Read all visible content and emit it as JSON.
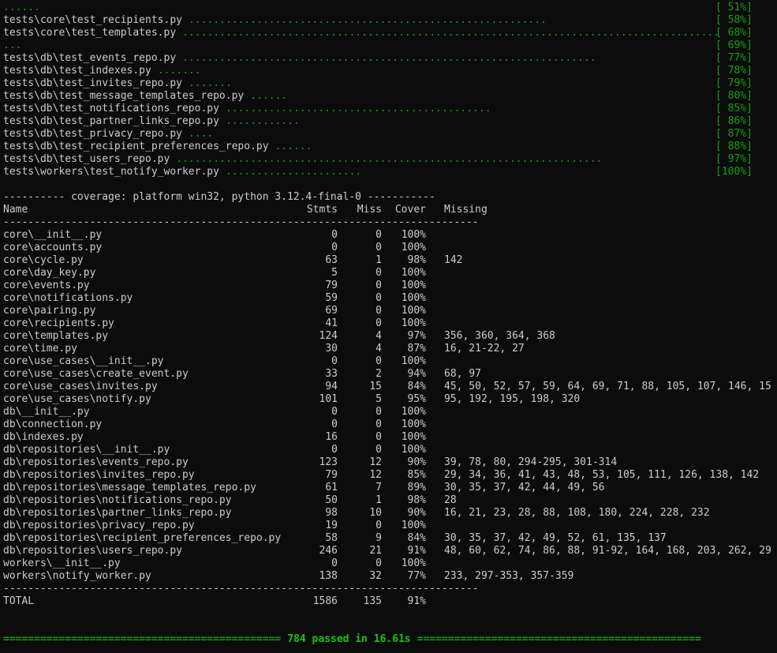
{
  "progress": [
    {
      "name": "",
      "dots": "......",
      "pct": "[ 51%]"
    },
    {
      "name": "tests\\core\\test_recipients.py",
      "dots": "..........................................................",
      "pct": "[ 58%]"
    },
    {
      "name": "tests\\core\\test_templates.py",
      "dots": ".......................................................................................",
      "pct": "[ 68%]"
    },
    {
      "name": "",
      "dots": "...",
      "pct": "[ 69%]"
    },
    {
      "name": "tests\\db\\test_events_repo.py",
      "dots": "...................................................................",
      "pct": "[ 77%]"
    },
    {
      "name": "tests\\db\\test_indexes.py",
      "dots": ".......",
      "pct": "[ 78%]"
    },
    {
      "name": "tests\\db\\test_invites_repo.py",
      "dots": ".......",
      "pct": "[ 79%]"
    },
    {
      "name": "tests\\db\\test_message_templates_repo.py",
      "dots": "......",
      "pct": "[ 80%]"
    },
    {
      "name": "tests\\db\\test_notifications_repo.py",
      "dots": "...........................................",
      "pct": "[ 85%]"
    },
    {
      "name": "tests\\db\\test_partner_links_repo.py",
      "dots": "............",
      "pct": "[ 86%]"
    },
    {
      "name": "tests\\db\\test_privacy_repo.py",
      "dots": "....",
      "pct": "[ 87%]"
    },
    {
      "name": "tests\\db\\test_recipient_preferences_repo.py",
      "dots": "......",
      "pct": "[ 88%]"
    },
    {
      "name": "tests\\db\\test_users_repo.py",
      "dots": ".....................................................................",
      "pct": "[ 97%]"
    },
    {
      "name": "tests\\workers\\test_notify_worker.py",
      "dots": "......................",
      "pct": "[100%]"
    }
  ],
  "coverage_title": "---------- coverage: platform win32, python 3.12.4-final-0 -----------",
  "headers": {
    "name": "Name",
    "stmts": "Stmts",
    "miss": "Miss",
    "cover": "Cover",
    "missing": "Missing"
  },
  "separator": "-----------------------------------------------------------------------------",
  "rows": [
    {
      "name": "core\\__init__.py",
      "stmts": "0",
      "miss": "0",
      "cover": "100%",
      "missing": ""
    },
    {
      "name": "core\\accounts.py",
      "stmts": "0",
      "miss": "0",
      "cover": "100%",
      "missing": ""
    },
    {
      "name": "core\\cycle.py",
      "stmts": "63",
      "miss": "1",
      "cover": "98%",
      "missing": "142"
    },
    {
      "name": "core\\day_key.py",
      "stmts": "5",
      "miss": "0",
      "cover": "100%",
      "missing": ""
    },
    {
      "name": "core\\events.py",
      "stmts": "79",
      "miss": "0",
      "cover": "100%",
      "missing": ""
    },
    {
      "name": "core\\notifications.py",
      "stmts": "59",
      "miss": "0",
      "cover": "100%",
      "missing": ""
    },
    {
      "name": "core\\pairing.py",
      "stmts": "69",
      "miss": "0",
      "cover": "100%",
      "missing": ""
    },
    {
      "name": "core\\recipients.py",
      "stmts": "41",
      "miss": "0",
      "cover": "100%",
      "missing": ""
    },
    {
      "name": "core\\templates.py",
      "stmts": "124",
      "miss": "4",
      "cover": "97%",
      "missing": "356, 360, 364, 368"
    },
    {
      "name": "core\\time.py",
      "stmts": "30",
      "miss": "4",
      "cover": "87%",
      "missing": "16, 21-22, 27"
    },
    {
      "name": "core\\use_cases\\__init__.py",
      "stmts": "0",
      "miss": "0",
      "cover": "100%",
      "missing": ""
    },
    {
      "name": "core\\use_cases\\create_event.py",
      "stmts": "33",
      "miss": "2",
      "cover": "94%",
      "missing": "68, 97"
    },
    {
      "name": "core\\use_cases\\invites.py",
      "stmts": "94",
      "miss": "15",
      "cover": "84%",
      "missing": "45, 50, 52, 57, 59, 64, 69, 71, 88, 105, 107, 146, 15"
    },
    {
      "name": "core\\use_cases\\notify.py",
      "stmts": "101",
      "miss": "5",
      "cover": "95%",
      "missing": "95, 192, 195, 198, 320"
    },
    {
      "name": "db\\__init__.py",
      "stmts": "0",
      "miss": "0",
      "cover": "100%",
      "missing": ""
    },
    {
      "name": "db\\connection.py",
      "stmts": "0",
      "miss": "0",
      "cover": "100%",
      "missing": ""
    },
    {
      "name": "db\\indexes.py",
      "stmts": "16",
      "miss": "0",
      "cover": "100%",
      "missing": ""
    },
    {
      "name": "db\\repositories\\__init__.py",
      "stmts": "0",
      "miss": "0",
      "cover": "100%",
      "missing": ""
    },
    {
      "name": "db\\repositories\\events_repo.py",
      "stmts": "123",
      "miss": "12",
      "cover": "90%",
      "missing": "39, 78, 80, 294-295, 301-314"
    },
    {
      "name": "db\\repositories\\invites_repo.py",
      "stmts": "79",
      "miss": "12",
      "cover": "85%",
      "missing": "29, 34, 36, 41, 43, 48, 53, 105, 111, 126, 138, 142"
    },
    {
      "name": "db\\repositories\\message_templates_repo.py",
      "stmts": "61",
      "miss": "7",
      "cover": "89%",
      "missing": "30, 35, 37, 42, 44, 49, 56"
    },
    {
      "name": "db\\repositories\\notifications_repo.py",
      "stmts": "50",
      "miss": "1",
      "cover": "98%",
      "missing": "28"
    },
    {
      "name": "db\\repositories\\partner_links_repo.py",
      "stmts": "98",
      "miss": "10",
      "cover": "90%",
      "missing": "16, 21, 23, 28, 88, 108, 180, 224, 228, 232"
    },
    {
      "name": "db\\repositories\\privacy_repo.py",
      "stmts": "19",
      "miss": "0",
      "cover": "100%",
      "missing": ""
    },
    {
      "name": "db\\repositories\\recipient_preferences_repo.py",
      "stmts": "58",
      "miss": "9",
      "cover": "84%",
      "missing": "30, 35, 37, 42, 49, 52, 61, 135, 137"
    },
    {
      "name": "db\\repositories\\users_repo.py",
      "stmts": "246",
      "miss": "21",
      "cover": "91%",
      "missing": "48, 60, 62, 74, 86, 88, 91-92, 164, 168, 203, 262, 29"
    },
    {
      "name": "workers\\__init__.py",
      "stmts": "0",
      "miss": "0",
      "cover": "100%",
      "missing": ""
    },
    {
      "name": "workers\\notify_worker.py",
      "stmts": "138",
      "miss": "32",
      "cover": "77%",
      "missing": "233, 297-353, 357-359"
    }
  ],
  "total": {
    "name": "TOTAL",
    "stmts": "1586",
    "miss": "135",
    "cover": "91%",
    "missing": ""
  },
  "summary": {
    "left_rule": "=============================================",
    "text": "784 passed in 16.61s",
    "right_rule": "=============================================="
  },
  "colors": {
    "background": "#0c0c0c",
    "text": "#cccccc",
    "green": "#13a10e",
    "bright_green": "#16c60c"
  }
}
